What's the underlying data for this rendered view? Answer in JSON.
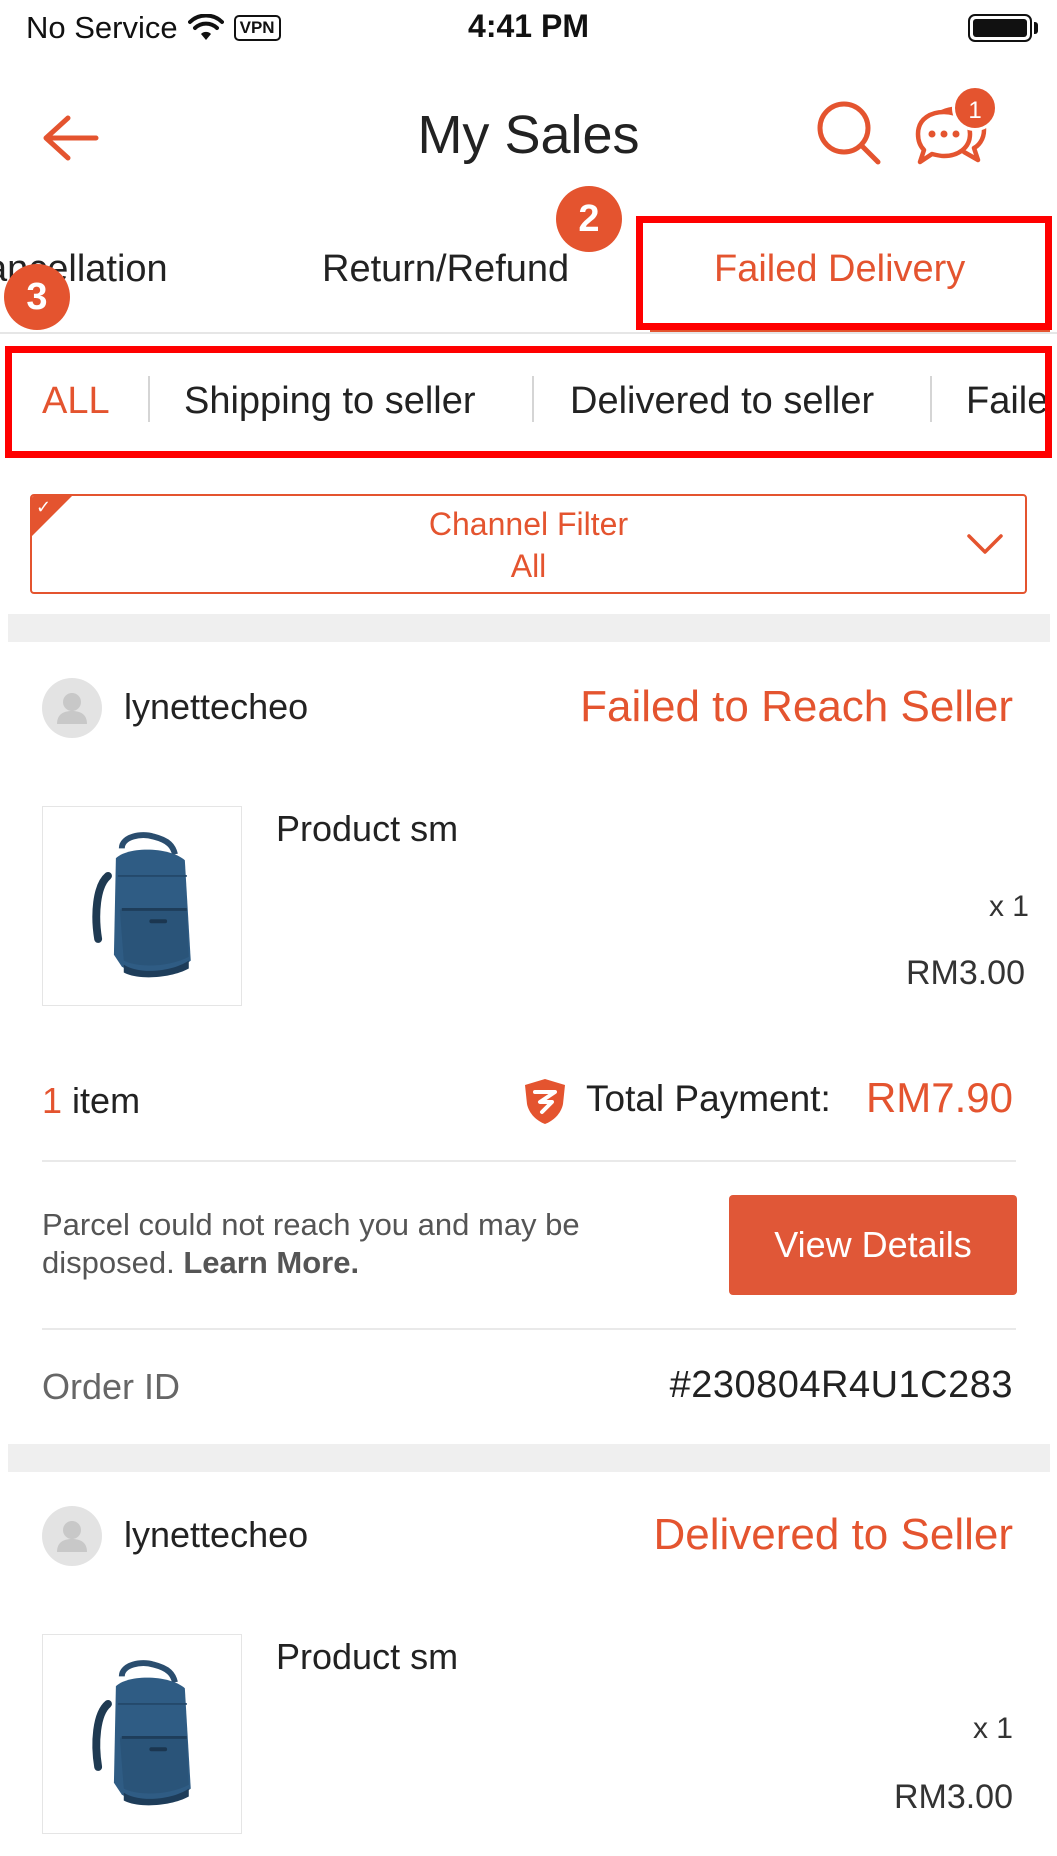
{
  "status_bar": {
    "carrier": "No Service",
    "vpn": "VPN",
    "time": "4:41 PM"
  },
  "header": {
    "title": "My Sales",
    "chat_badge_count": "1"
  },
  "tabs": {
    "items": [
      {
        "label": "ancellation",
        "active": false
      },
      {
        "label": "Return/Refund",
        "active": false
      },
      {
        "label": "Failed Delivery",
        "active": true
      }
    ]
  },
  "annotations": {
    "marker_2": "2",
    "marker_3": "3"
  },
  "sub_filters": {
    "items": [
      {
        "label": "ALL",
        "active": true
      },
      {
        "label": "Shipping to seller",
        "active": false
      },
      {
        "label": "Delivered to seller",
        "active": false
      },
      {
        "label": "Failed",
        "active": false
      }
    ]
  },
  "channel_filter": {
    "label": "Channel Filter",
    "value": "All"
  },
  "orders": [
    {
      "buyer": "lynettecheo",
      "status": "Failed to Reach Seller",
      "product_name": "Product sm",
      "quantity": "x 1",
      "price": "RM3.00",
      "item_count": "1",
      "item_word": "item",
      "total_label": "Total Payment:",
      "total_value": "RM7.90",
      "notice": "Parcel could not reach you and may be disposed.",
      "notice_link": "Learn More.",
      "action_label": "View Details",
      "order_id_label": "Order ID",
      "order_id": "#230804R4U1C283"
    },
    {
      "buyer": "lynettecheo",
      "status": "Delivered to Seller",
      "product_name": "Product sm",
      "quantity": "x 1",
      "price": "RM3.00"
    }
  ],
  "colors": {
    "accent": "#e4542f",
    "highlight": "#ff0000"
  }
}
